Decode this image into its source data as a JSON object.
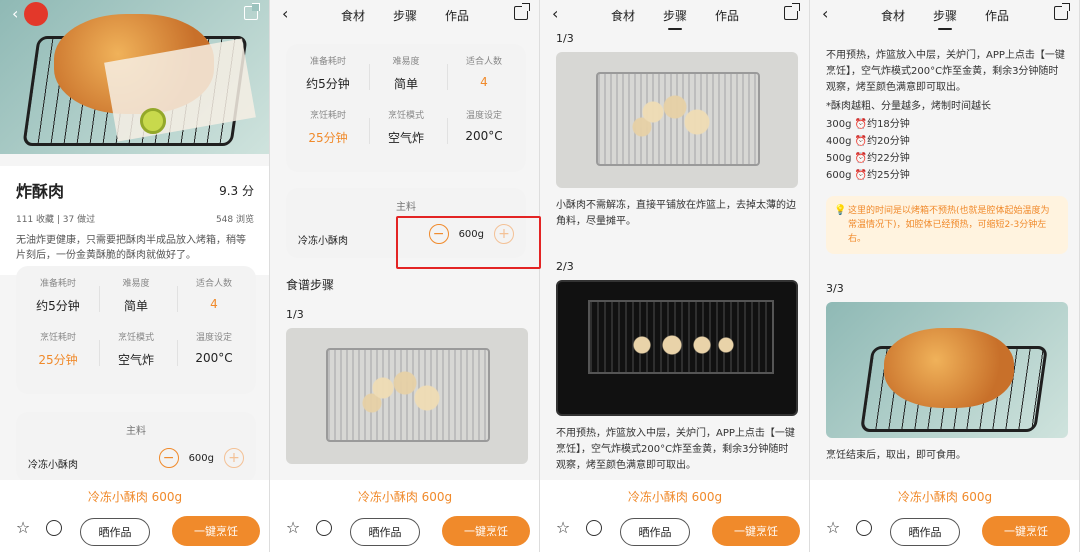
{
  "common": {
    "tabs": [
      "食材",
      "步骤",
      "作品"
    ],
    "bottom_ingredient": "冷冻小酥肉 600g",
    "btn_show": "晒作品",
    "btn_cook": "一键烹饪",
    "icons": {
      "star": "star-icon",
      "comment": "comment-icon",
      "share": "share-icon",
      "back": "back-icon",
      "minus": "minus-icon",
      "plus": "plus-icon"
    }
  },
  "recipe": {
    "title": "炸酥肉",
    "score": "9.3 分",
    "meta_left": "111 收藏 | 37 做过",
    "meta_right": "548 浏览",
    "description": "无油炸更健康，只需要把酥肉半成品放入烤箱，稍等片刻后，一份金黄酥脆的酥肉就做好了。"
  },
  "stats": {
    "row1": [
      {
        "label": "准备耗时",
        "value": "约5分钟"
      },
      {
        "label": "难易度",
        "value": "简单"
      },
      {
        "label": "适合人数",
        "value": "4"
      }
    ],
    "row2": [
      {
        "label": "烹饪耗时",
        "value": "25分钟"
      },
      {
        "label": "烹饪模式",
        "value": "空气炸"
      },
      {
        "label": "温度设定",
        "value": "200°C"
      }
    ]
  },
  "main_ingredients": {
    "title": "主料",
    "name": "冷冻小酥肉",
    "qty": "600g"
  },
  "steps": {
    "section_title": "食谱步骤",
    "step1_label": "1/3",
    "step1_text": "小酥肉不需解冻，直接平铺放在炸篮上，去掉太薄的边角料，尽量摊平。",
    "step2_label": "2/3",
    "step2_text": "不用预热，炸篮放入中层，关炉门，APP上点击【一键烹饪】，空气炸模式200°C炸至金黄，剩余3分钟随时观察，烤至颜色满意即可取出。",
    "step2_text_p4": "不用预热，炸篮放入中层，关炉门，APP上点击【一键烹饪】，空气炸模式200°C炸至金黄，剩余3分钟随时观察，烤至颜色满意即可取出。",
    "note": "*酥肉越粗、分量越多，烤制时间越长",
    "timings": [
      "300g ⏰约18分钟",
      "400g ⏰约20分钟",
      "500g ⏰约22分钟",
      "600g ⏰约25分钟"
    ],
    "tip": "这里的时间是以烤箱不预热(也就是腔体起始温度为常温情况下)，如腔体已经预热，可缩短2-3分钟左右。",
    "step3_label": "3/3",
    "step3_text": "烹饪结束后，取出，即可食用。"
  }
}
